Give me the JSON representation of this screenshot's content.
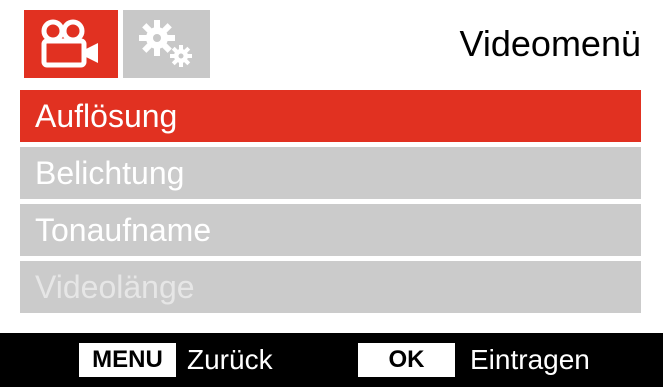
{
  "header": {
    "title": "Videomenü",
    "tabs": [
      {
        "icon": "video-camera-icon",
        "active": true,
        "color": "#e13121"
      },
      {
        "icon": "gears-icon",
        "active": false,
        "color": "#c8c8c8"
      }
    ]
  },
  "menu": {
    "items": [
      {
        "label": "Auflösung",
        "state": "selected"
      },
      {
        "label": "Belichtung",
        "state": "normal"
      },
      {
        "label": "Tonaufname",
        "state": "normal"
      },
      {
        "label": "Videolänge",
        "state": "disabled"
      }
    ],
    "accent_color": "#e13121",
    "item_color": "#cbcbcb"
  },
  "footer": {
    "menu_key": "MENU",
    "menu_action": "Zurück",
    "ok_key": "OK",
    "ok_action": "Eintragen"
  }
}
